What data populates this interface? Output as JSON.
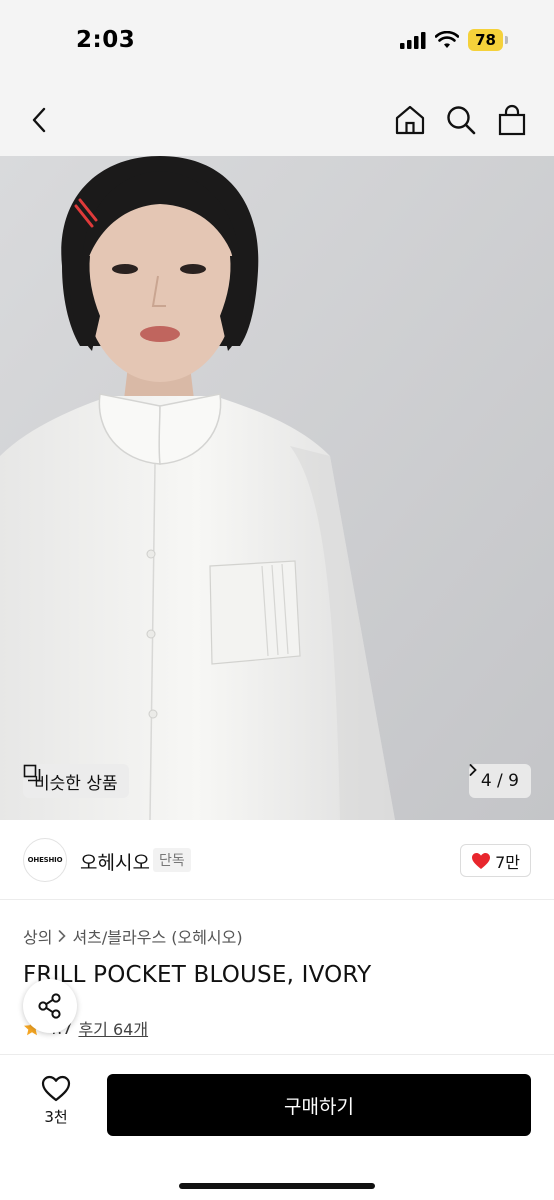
{
  "status_bar": {
    "time": "2:03",
    "battery": "78"
  },
  "nav": {
    "back_icon": "chevron-left-icon",
    "home_icon": "home-icon",
    "search_icon": "search-icon",
    "bag_icon": "shopping-bag-icon"
  },
  "hero": {
    "similar_label": "비슷한 상품",
    "page_indicator": "4 / 9"
  },
  "brand": {
    "logo_text": "OHESHIO",
    "name": "오헤시오",
    "badge": "단독",
    "like_count": "7만",
    "like_color": "#e8262d"
  },
  "product": {
    "breadcrumb": [
      "상의",
      "셔츠/블라우스 (오헤시오)"
    ],
    "title": "FRILL POCKET BLOUSE, IVORY",
    "rating": "4.7",
    "reviews": "후기 64개",
    "star_color": "#f5a623"
  },
  "bottom": {
    "wish_count": "3천",
    "buy_label": "구매하기"
  }
}
